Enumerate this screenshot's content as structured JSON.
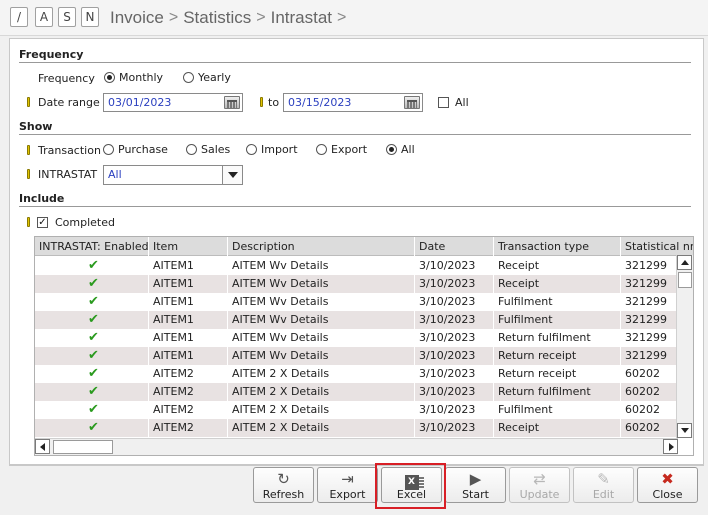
{
  "header": {
    "letters": [
      "/",
      "A",
      "S",
      "N"
    ],
    "breadcrumbs": [
      "Invoice",
      "Statistics",
      "Intrastat"
    ],
    "separator": ">"
  },
  "frequency": {
    "title": "Frequency",
    "label": "Frequency",
    "options": [
      {
        "label": "Monthly",
        "selected": true
      },
      {
        "label": "Yearly",
        "selected": false
      }
    ],
    "date_range_label": "Date range",
    "date_from": "03/01/2023",
    "to_label": "to",
    "date_to": "03/15/2023",
    "all_label": "All",
    "all_checked": false
  },
  "show": {
    "title": "Show",
    "transaction_label": "Transaction",
    "transaction_options": [
      {
        "label": "Purchase",
        "selected": false
      },
      {
        "label": "Sales",
        "selected": false
      },
      {
        "label": "Import",
        "selected": false
      },
      {
        "label": "Export",
        "selected": false
      },
      {
        "label": "All",
        "selected": true
      }
    ],
    "intrastat_label": "INTRASTAT",
    "intrastat_value": "All"
  },
  "include": {
    "title": "Include",
    "completed_label": "Completed",
    "completed_checked": true,
    "check_glyph": "✓"
  },
  "grid": {
    "columns": [
      "INTRASTAT: Enabled",
      "Item",
      "Description",
      "Date",
      "Transaction type",
      "Statistical nr."
    ],
    "rows": [
      {
        "enabled": "✔",
        "item": "AITEM1",
        "description": "AITEM Wv Details",
        "date": "3/10/2023",
        "type": "Receipt",
        "stat": "321299"
      },
      {
        "enabled": "✔",
        "item": "AITEM1",
        "description": "AITEM Wv Details",
        "date": "3/10/2023",
        "type": "Receipt",
        "stat": "321299"
      },
      {
        "enabled": "✔",
        "item": "AITEM1",
        "description": "AITEM Wv Details",
        "date": "3/10/2023",
        "type": "Fulfilment",
        "stat": "321299"
      },
      {
        "enabled": "✔",
        "item": "AITEM1",
        "description": "AITEM Wv Details",
        "date": "3/10/2023",
        "type": "Fulfilment",
        "stat": "321299"
      },
      {
        "enabled": "✔",
        "item": "AITEM1",
        "description": "AITEM Wv Details",
        "date": "3/10/2023",
        "type": "Return fulfilment",
        "stat": "321299"
      },
      {
        "enabled": "✔",
        "item": "AITEM1",
        "description": "AITEM Wv Details",
        "date": "3/10/2023",
        "type": "Return receipt",
        "stat": "321299"
      },
      {
        "enabled": "✔",
        "item": "AITEM2",
        "description": "AITEM 2 X Details",
        "date": "3/10/2023",
        "type": "Return receipt",
        "stat": "60202"
      },
      {
        "enabled": "✔",
        "item": "AITEM2",
        "description": "AITEM 2 X Details",
        "date": "3/10/2023",
        "type": "Return fulfilment",
        "stat": "60202"
      },
      {
        "enabled": "✔",
        "item": "AITEM2",
        "description": "AITEM 2 X Details",
        "date": "3/10/2023",
        "type": "Fulfilment",
        "stat": "60202"
      },
      {
        "enabled": "✔",
        "item": "AITEM2",
        "description": "AITEM 2 X Details",
        "date": "3/10/2023",
        "type": "Receipt",
        "stat": "60202"
      }
    ]
  },
  "toolbar": {
    "refresh": {
      "label": "Refresh",
      "icon": "refresh-icon",
      "glyph": "↻"
    },
    "export": {
      "label": "Export",
      "icon": "export-icon",
      "glyph": "⇥"
    },
    "excel": {
      "label": "Excel",
      "icon": "excel-icon",
      "glyph": "X"
    },
    "start": {
      "label": "Start",
      "icon": "play-icon",
      "glyph": "▶"
    },
    "update": {
      "label": "Update",
      "icon": "sync-icon",
      "glyph": "⇄"
    },
    "edit": {
      "label": "Edit",
      "icon": "pencil-icon",
      "glyph": "✎"
    },
    "close": {
      "label": "Close",
      "icon": "close-icon",
      "glyph": "✖"
    }
  },
  "colors": {
    "highlight": "#d81f26",
    "check": "#2a9a1e",
    "input_text": "#2a3fbf",
    "required_marker": "#e2c400"
  }
}
